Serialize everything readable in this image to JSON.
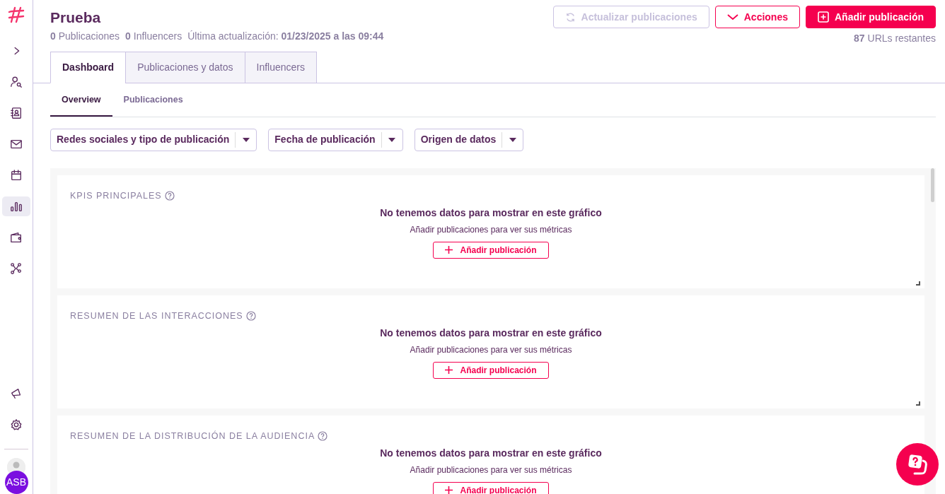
{
  "sidebar": {
    "items": [
      {
        "kind": "chevron",
        "selected": false
      },
      {
        "kind": "user-search",
        "selected": false
      },
      {
        "kind": "contacts",
        "selected": false
      },
      {
        "kind": "mail",
        "selected": false
      },
      {
        "kind": "calendar",
        "selected": false
      },
      {
        "kind": "bars",
        "selected": true
      },
      {
        "kind": "wallet",
        "selected": false
      },
      {
        "kind": "network",
        "selected": false
      }
    ],
    "bottom_items": [
      {
        "kind": "megaphone"
      },
      {
        "kind": "gear"
      }
    ],
    "avatar": "ASB"
  },
  "header": {
    "title": "Prueba",
    "stats": [
      {
        "count": "0",
        "label": "Publicaciones"
      },
      {
        "count": "0",
        "label": "Influencers"
      }
    ],
    "last_update_label": "Última actualización:",
    "last_update_value": "01/23/2025 a las 09:44",
    "buttons": [
      {
        "kind": "refresh",
        "label": "Actualizar publicaciones",
        "disabled": true
      },
      {
        "kind": "actions",
        "label": "Acciones",
        "disabled": false
      },
      {
        "kind": "add",
        "label": "Añadir publicación",
        "disabled": false
      }
    ],
    "urls_count": "87",
    "urls_label": "URLs restantes"
  },
  "tabs": [
    {
      "label": "Dashboard",
      "selected": true
    },
    {
      "label": "Publicaciones y datos",
      "selected": false
    },
    {
      "label": "Influencers",
      "selected": false
    }
  ],
  "subtabs": [
    {
      "label": "Overview",
      "selected": true
    },
    {
      "label": "Publicaciones",
      "selected": false
    }
  ],
  "filters": [
    {
      "label": "Redes sociales y tipo de publicación"
    },
    {
      "label": "Fecha de publicación"
    },
    {
      "label": "Origen de datos"
    }
  ],
  "widgets": [
    {
      "title": "KPIS PRINCIPALES",
      "empty_title": "No tenemos datos para mostrar en este gráfico",
      "empty_text": "Añadir publicaciones para ver sus métricas",
      "button": "Añadir publicación"
    },
    {
      "title": "RESUMEN DE LAS INTERACCIONES",
      "empty_title": "No tenemos datos para mostrar en este gráfico",
      "empty_text": "Añadir publicaciones para ver sus métricas",
      "button": "Añadir publicación"
    },
    {
      "title": "RESUMEN DE LA DISTRIBUCIÓN DE LA AUDIENCIA",
      "empty_title": "No tenemos datos para mostrar en este gráfico",
      "empty_text": "Añadir publicaciones para ver sus métricas",
      "button": "Añadir publicación"
    }
  ]
}
